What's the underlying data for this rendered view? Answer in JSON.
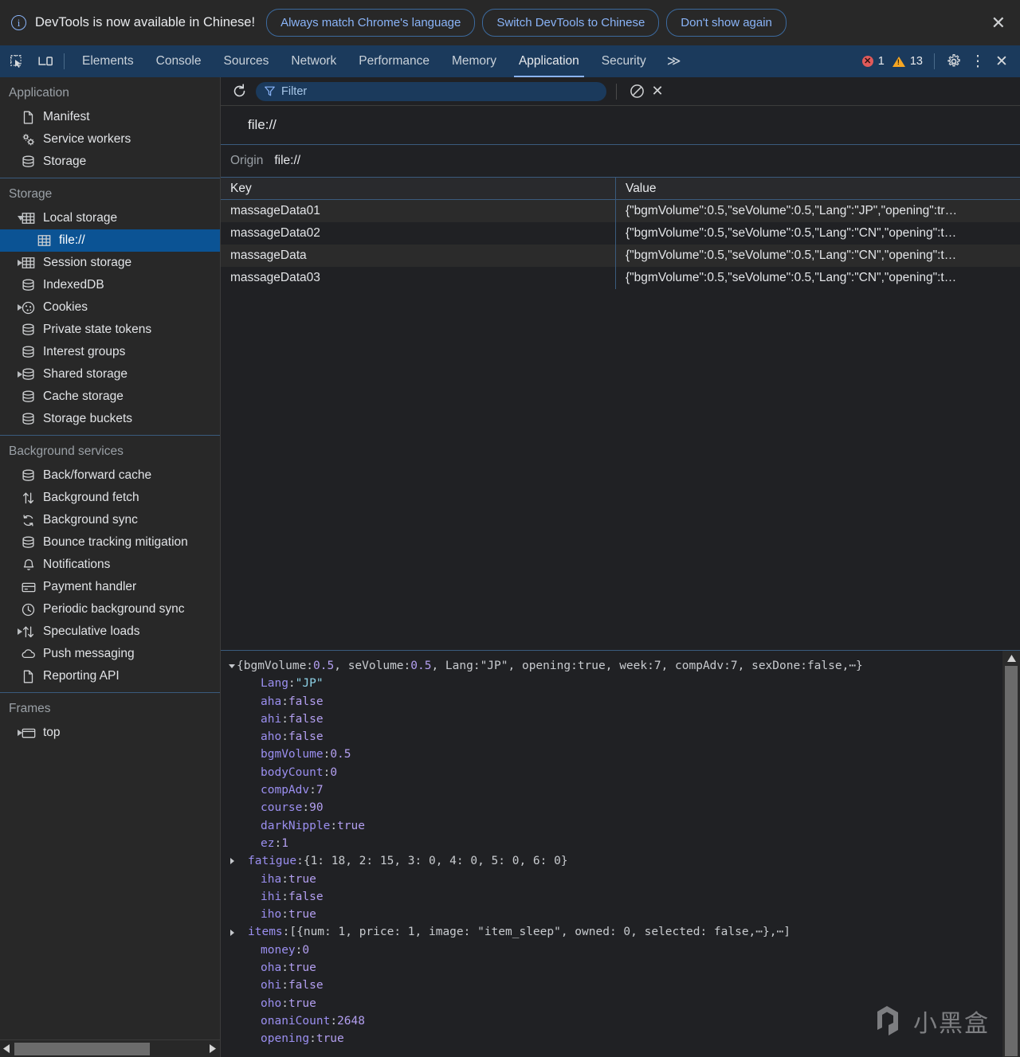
{
  "banner": {
    "icon": "info-icon",
    "message": "DevTools is now available in Chinese!",
    "buttons": [
      {
        "label": "Always match Chrome's language"
      },
      {
        "label": "Switch DevTools to Chinese"
      },
      {
        "label": "Don't show again"
      }
    ],
    "close_label": "✕"
  },
  "toolbar": {
    "left_icons": [
      {
        "name": "inspect-element-icon"
      },
      {
        "name": "device-toolbar-icon"
      }
    ],
    "tabs": [
      {
        "label": "Elements",
        "active": false
      },
      {
        "label": "Console",
        "active": false
      },
      {
        "label": "Sources",
        "active": false
      },
      {
        "label": "Network",
        "active": false
      },
      {
        "label": "Performance",
        "active": false
      },
      {
        "label": "Memory",
        "active": false
      },
      {
        "label": "Application",
        "active": true
      },
      {
        "label": "Security",
        "active": false
      }
    ],
    "more_tabs_label": "≫",
    "error_count": "1",
    "warning_count": "13",
    "error_color": "#e05a5a",
    "warning_color": "#f5a623",
    "settings_label": "gear-icon",
    "menu_label": "⋮",
    "close_label": "✕",
    "accent_color": "#8ab4f8",
    "toolbar_bg": "#1b3a5c"
  },
  "sidebar": {
    "sections": [
      {
        "title": "Application",
        "items": [
          {
            "label": "Manifest",
            "icon": "document-icon",
            "arrow": "none",
            "indent": 0,
            "selected": false
          },
          {
            "label": "Service workers",
            "icon": "gears-icon",
            "arrow": "none",
            "indent": 0,
            "selected": false
          },
          {
            "label": "Storage",
            "icon": "database-icon",
            "arrow": "none",
            "indent": 0,
            "selected": false
          }
        ]
      },
      {
        "title": "Storage",
        "items": [
          {
            "label": "Local storage",
            "icon": "table-icon",
            "arrow": "open",
            "indent": 0,
            "selected": false
          },
          {
            "label": "file://",
            "icon": "table-icon",
            "arrow": "none",
            "indent": 1,
            "selected": true
          },
          {
            "label": "Session storage",
            "icon": "table-icon",
            "arrow": "closed",
            "indent": 0,
            "selected": false
          },
          {
            "label": "IndexedDB",
            "icon": "database-icon",
            "arrow": "none",
            "indent": 0,
            "selected": false
          },
          {
            "label": "Cookies",
            "icon": "cookie-icon",
            "arrow": "closed",
            "indent": 0,
            "selected": false
          },
          {
            "label": "Private state tokens",
            "icon": "database-icon",
            "arrow": "none",
            "indent": 0,
            "selected": false
          },
          {
            "label": "Interest groups",
            "icon": "database-icon",
            "arrow": "none",
            "indent": 0,
            "selected": false
          },
          {
            "label": "Shared storage",
            "icon": "database-icon",
            "arrow": "closed",
            "indent": 0,
            "selected": false
          },
          {
            "label": "Cache storage",
            "icon": "database-icon",
            "arrow": "none",
            "indent": 0,
            "selected": false
          },
          {
            "label": "Storage buckets",
            "icon": "database-icon",
            "arrow": "none",
            "indent": 0,
            "selected": false
          }
        ]
      },
      {
        "title": "Background services",
        "items": [
          {
            "label": "Back/forward cache",
            "icon": "database-icon",
            "arrow": "none",
            "indent": 0,
            "selected": false
          },
          {
            "label": "Background fetch",
            "icon": "updown-arrows-icon",
            "arrow": "none",
            "indent": 0,
            "selected": false
          },
          {
            "label": "Background sync",
            "icon": "sync-icon",
            "arrow": "none",
            "indent": 0,
            "selected": false
          },
          {
            "label": "Bounce tracking mitigation",
            "icon": "database-icon",
            "arrow": "none",
            "indent": 0,
            "selected": false
          },
          {
            "label": "Notifications",
            "icon": "bell-icon",
            "arrow": "none",
            "indent": 0,
            "selected": false
          },
          {
            "label": "Payment handler",
            "icon": "credit-card-icon",
            "arrow": "none",
            "indent": 0,
            "selected": false
          },
          {
            "label": "Periodic background sync",
            "icon": "clock-icon",
            "arrow": "none",
            "indent": 0,
            "selected": false
          },
          {
            "label": "Speculative loads",
            "icon": "updown-arrows-icon",
            "arrow": "closed",
            "indent": 0,
            "selected": false
          },
          {
            "label": "Push messaging",
            "icon": "cloud-icon",
            "arrow": "none",
            "indent": 0,
            "selected": false
          },
          {
            "label": "Reporting API",
            "icon": "document-icon",
            "arrow": "none",
            "indent": 0,
            "selected": false
          }
        ]
      },
      {
        "title": "Frames",
        "items": [
          {
            "label": "top",
            "icon": "frame-icon",
            "arrow": "closed",
            "indent": 0,
            "selected": false
          }
        ]
      }
    ]
  },
  "filterbar": {
    "refresh_label": "refresh-icon",
    "filter_placeholder": "Filter",
    "clear_label": "clear-icon",
    "delete_label": "✕"
  },
  "storage_view": {
    "origin_title": "file://",
    "origin_label": "Origin",
    "origin_value": "file://",
    "columns": [
      "Key",
      "Value"
    ],
    "rows": [
      {
        "key": "massageData01",
        "value": "{\"bgmVolume\":0.5,\"seVolume\":0.5,\"Lang\":\"JP\",\"opening\":tr…"
      },
      {
        "key": "massageData02",
        "value": "{\"bgmVolume\":0.5,\"seVolume\":0.5,\"Lang\":\"CN\",\"opening\":t…"
      },
      {
        "key": "massageData",
        "value": "{\"bgmVolume\":0.5,\"seVolume\":0.5,\"Lang\":\"CN\",\"opening\":t…"
      },
      {
        "key": "massageData03",
        "value": "{\"bgmVolume\":0.5,\"seVolume\":0.5,\"Lang\":\"CN\",\"opening\":t…"
      }
    ]
  },
  "preview": {
    "lines": [
      {
        "tri": "open",
        "indent": 0,
        "parts": [
          {
            "t": "{bgmVolume: ",
            "c": "plain"
          },
          {
            "t": "0.5",
            "c": "num"
          },
          {
            "t": ", seVolume: ",
            "c": "plain"
          },
          {
            "t": "0.5",
            "c": "num"
          },
          {
            "t": ", Lang: ",
            "c": "plain"
          },
          {
            "t": "\"JP\"",
            "c": "plain"
          },
          {
            "t": ", opening: ",
            "c": "plain"
          },
          {
            "t": "true",
            "c": "plain"
          },
          {
            "t": ", week: ",
            "c": "plain"
          },
          {
            "t": "7",
            "c": "plain"
          },
          {
            "t": ", compAdv: ",
            "c": "plain"
          },
          {
            "t": "7",
            "c": "plain"
          },
          {
            "t": ", sexDone: ",
            "c": "plain"
          },
          {
            "t": "false",
            "c": "plain"
          },
          {
            "t": ",⋯}",
            "c": "plain"
          }
        ]
      },
      {
        "tri": "none",
        "indent": 1,
        "parts": [
          {
            "t": "Lang",
            "c": "key"
          },
          {
            "t": ": ",
            "c": "punct"
          },
          {
            "t": "\"JP\"",
            "c": "str"
          }
        ]
      },
      {
        "tri": "none",
        "indent": 1,
        "parts": [
          {
            "t": "aha",
            "c": "key"
          },
          {
            "t": ": ",
            "c": "punct"
          },
          {
            "t": "false",
            "c": "bool"
          }
        ]
      },
      {
        "tri": "none",
        "indent": 1,
        "parts": [
          {
            "t": "ahi",
            "c": "key"
          },
          {
            "t": ": ",
            "c": "punct"
          },
          {
            "t": "false",
            "c": "bool"
          }
        ]
      },
      {
        "tri": "none",
        "indent": 1,
        "parts": [
          {
            "t": "aho",
            "c": "key"
          },
          {
            "t": ": ",
            "c": "punct"
          },
          {
            "t": "false",
            "c": "bool"
          }
        ]
      },
      {
        "tri": "none",
        "indent": 1,
        "parts": [
          {
            "t": "bgmVolume",
            "c": "key"
          },
          {
            "t": ": ",
            "c": "punct"
          },
          {
            "t": "0.5",
            "c": "num"
          }
        ]
      },
      {
        "tri": "none",
        "indent": 1,
        "parts": [
          {
            "t": "bodyCount",
            "c": "key"
          },
          {
            "t": ": ",
            "c": "punct"
          },
          {
            "t": "0",
            "c": "num"
          }
        ]
      },
      {
        "tri": "none",
        "indent": 1,
        "parts": [
          {
            "t": "compAdv",
            "c": "key"
          },
          {
            "t": ": ",
            "c": "punct"
          },
          {
            "t": "7",
            "c": "num"
          }
        ]
      },
      {
        "tri": "none",
        "indent": 1,
        "parts": [
          {
            "t": "course",
            "c": "key"
          },
          {
            "t": ": ",
            "c": "punct"
          },
          {
            "t": "90",
            "c": "num"
          }
        ]
      },
      {
        "tri": "none",
        "indent": 1,
        "parts": [
          {
            "t": "darkNipple",
            "c": "key"
          },
          {
            "t": ": ",
            "c": "punct"
          },
          {
            "t": "true",
            "c": "bool"
          }
        ]
      },
      {
        "tri": "none",
        "indent": 1,
        "parts": [
          {
            "t": "ez",
            "c": "key"
          },
          {
            "t": ": ",
            "c": "punct"
          },
          {
            "t": "1",
            "c": "num"
          }
        ]
      },
      {
        "tri": "closed",
        "indent": 1,
        "parts": [
          {
            "t": "fatigue",
            "c": "key"
          },
          {
            "t": ": ",
            "c": "punct"
          },
          {
            "t": "{1: 18, 2: 15, 3: 0, 4: 0, 5: 0, 6: 0}",
            "c": "plain"
          }
        ]
      },
      {
        "tri": "none",
        "indent": 1,
        "parts": [
          {
            "t": "iha",
            "c": "key"
          },
          {
            "t": ": ",
            "c": "punct"
          },
          {
            "t": "true",
            "c": "bool"
          }
        ]
      },
      {
        "tri": "none",
        "indent": 1,
        "parts": [
          {
            "t": "ihi",
            "c": "key"
          },
          {
            "t": ": ",
            "c": "punct"
          },
          {
            "t": "false",
            "c": "bool"
          }
        ]
      },
      {
        "tri": "none",
        "indent": 1,
        "parts": [
          {
            "t": "iho",
            "c": "key"
          },
          {
            "t": ": ",
            "c": "punct"
          },
          {
            "t": "true",
            "c": "bool"
          }
        ]
      },
      {
        "tri": "closed",
        "indent": 1,
        "parts": [
          {
            "t": "items",
            "c": "key"
          },
          {
            "t": ": ",
            "c": "punct"
          },
          {
            "t": "[{num: 1, price: 1, image: \"item_sleep\", owned: 0, selected: false,⋯},⋯]",
            "c": "plain"
          }
        ]
      },
      {
        "tri": "none",
        "indent": 1,
        "parts": [
          {
            "t": "money",
            "c": "key"
          },
          {
            "t": ": ",
            "c": "punct"
          },
          {
            "t": "0",
            "c": "num"
          }
        ]
      },
      {
        "tri": "none",
        "indent": 1,
        "parts": [
          {
            "t": "oha",
            "c": "key"
          },
          {
            "t": ": ",
            "c": "punct"
          },
          {
            "t": "true",
            "c": "bool"
          }
        ]
      },
      {
        "tri": "none",
        "indent": 1,
        "parts": [
          {
            "t": "ohi",
            "c": "key"
          },
          {
            "t": ": ",
            "c": "punct"
          },
          {
            "t": "false",
            "c": "bool"
          }
        ]
      },
      {
        "tri": "none",
        "indent": 1,
        "parts": [
          {
            "t": "oho",
            "c": "key"
          },
          {
            "t": ": ",
            "c": "punct"
          },
          {
            "t": "true",
            "c": "bool"
          }
        ]
      },
      {
        "tri": "none",
        "indent": 1,
        "parts": [
          {
            "t": "onaniCount",
            "c": "key"
          },
          {
            "t": ": ",
            "c": "punct"
          },
          {
            "t": "2648",
            "c": "num"
          }
        ]
      },
      {
        "tri": "none",
        "indent": 1,
        "parts": [
          {
            "t": "opening",
            "c": "key"
          },
          {
            "t": ": ",
            "c": "punct"
          },
          {
            "t": "true",
            "c": "bool"
          }
        ]
      }
    ]
  },
  "watermark": {
    "text": "小黑盒"
  }
}
